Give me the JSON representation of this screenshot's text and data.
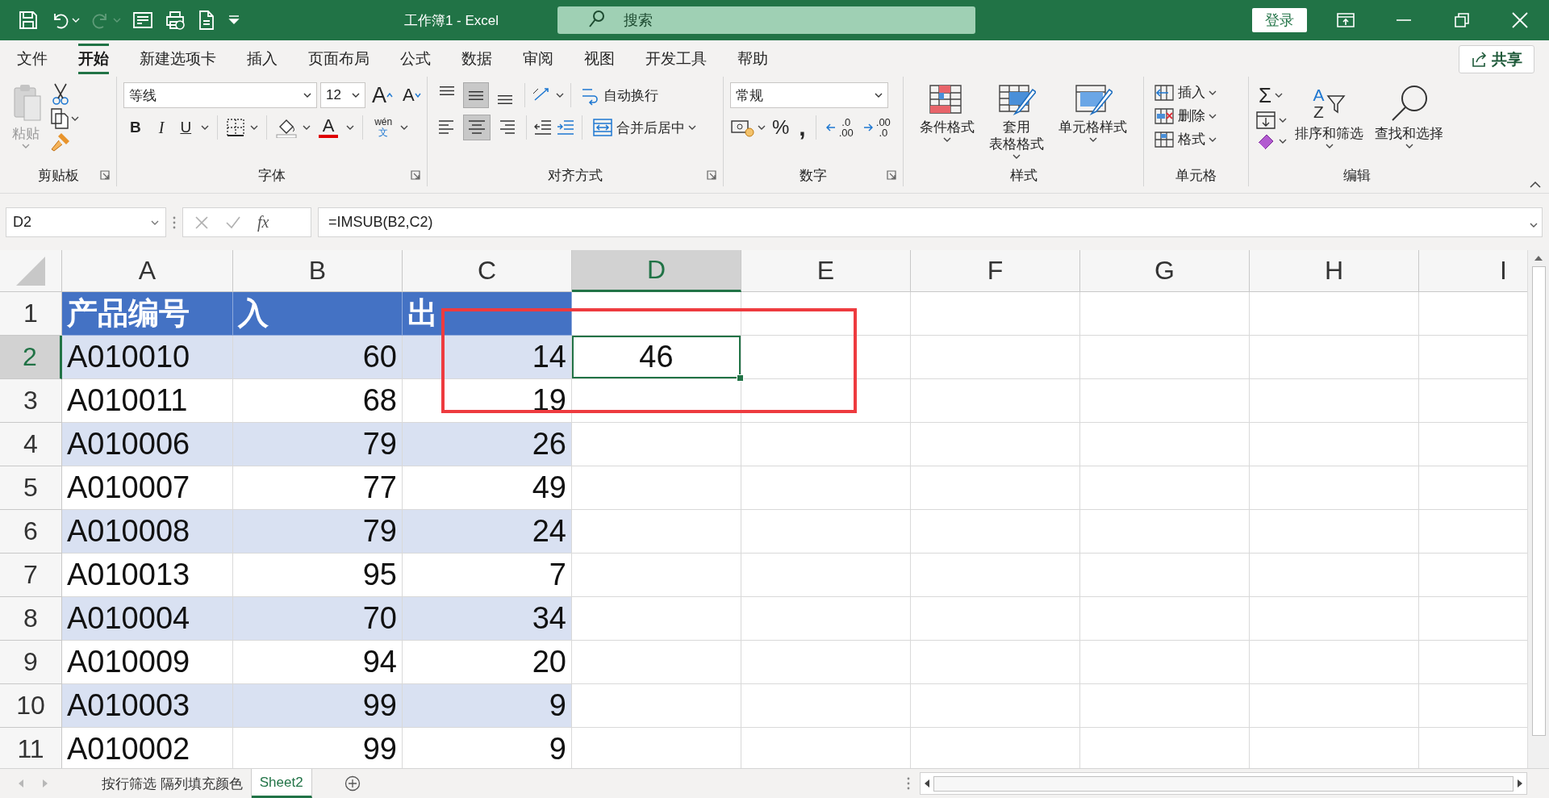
{
  "window": {
    "title": "工作簿1  -  Excel",
    "search_placeholder": "搜索",
    "sign_in": "登录"
  },
  "quick_access": [
    {
      "kind": "save",
      "disabled": false
    },
    {
      "kind": "undo",
      "disabled": false
    },
    {
      "kind": "redo",
      "disabled": true
    },
    {
      "kind": "form",
      "disabled": false
    },
    {
      "kind": "print",
      "disabled": false
    },
    {
      "kind": "document",
      "disabled": false
    },
    {
      "kind": "customize",
      "disabled": false
    }
  ],
  "tabs": [
    {
      "label": "文件",
      "selected": false
    },
    {
      "label": "开始",
      "selected": true
    },
    {
      "label": "新建选项卡",
      "selected": false
    },
    {
      "label": "插入",
      "selected": false
    },
    {
      "label": "页面布局",
      "selected": false
    },
    {
      "label": "公式",
      "selected": false
    },
    {
      "label": "数据",
      "selected": false
    },
    {
      "label": "审阅",
      "selected": false
    },
    {
      "label": "视图",
      "selected": false
    },
    {
      "label": "开发工具",
      "selected": false
    },
    {
      "label": "帮助",
      "selected": false
    }
  ],
  "share": "共享",
  "ribbon": {
    "clipboard": {
      "paste": "粘贴",
      "paste_disabled": true,
      "label": "剪贴板"
    },
    "font": {
      "name": "等线",
      "size": "12",
      "grow": "A",
      "shrink": "A",
      "bold": "B",
      "italic": "I",
      "underline": "U",
      "color_letter": "A",
      "phonetic_top": "wén",
      "phonetic_bottom": "文",
      "label": "字体"
    },
    "alignment": {
      "vertical": [
        {
          "kind": "top",
          "selected": false
        },
        {
          "kind": "middle",
          "selected": true
        },
        {
          "kind": "bottom",
          "selected": false
        }
      ],
      "horizontal": [
        {
          "kind": "left",
          "selected": false
        },
        {
          "kind": "center",
          "selected": true
        },
        {
          "kind": "right",
          "selected": false
        }
      ],
      "wrap": "自动换行",
      "merge": "合并后居中",
      "label": "对齐方式"
    },
    "number": {
      "format": "常规",
      "percent": "%",
      "comma": ",",
      "increase_decimal": [
        ".0",
        ".00"
      ],
      "decrease_decimal": [
        ".00",
        ".0"
      ],
      "label": "数字"
    },
    "styles": {
      "buttons": [
        {
          "kind": "conditional",
          "lines": [
            "条件格式"
          ]
        },
        {
          "kind": "table",
          "lines": [
            "套用",
            "表格格式"
          ]
        },
        {
          "kind": "cell",
          "lines": [
            "单元格样式"
          ]
        }
      ],
      "label": "样式"
    },
    "cells": {
      "buttons": [
        {
          "kind": "insert",
          "label": "插入"
        },
        {
          "kind": "delete",
          "label": "删除"
        },
        {
          "kind": "format",
          "label": "格式"
        }
      ],
      "label": "单元格"
    },
    "editing": {
      "sum": "Σ",
      "sort_letters": [
        "A",
        "Z"
      ],
      "sort": "排序和筛选",
      "find": "查找和选择",
      "label": "编辑"
    }
  },
  "formula_bar": {
    "name_box": "D2",
    "fx": "fx",
    "formula": "=IMSUB(B2,C2)"
  },
  "sheet": {
    "columns": [
      {
        "label": "A",
        "selected": false
      },
      {
        "label": "B",
        "selected": false
      },
      {
        "label": "C",
        "selected": false
      },
      {
        "label": "D",
        "selected": true
      },
      {
        "label": "E",
        "selected": false
      },
      {
        "label": "F",
        "selected": false
      },
      {
        "label": "G",
        "selected": false
      },
      {
        "label": "H",
        "selected": false
      },
      {
        "label": "I",
        "selected": false
      }
    ],
    "rows": [
      {
        "number": "1",
        "kind": "header",
        "selected": false,
        "cells": [
          "产品编号",
          "入",
          "出"
        ]
      },
      {
        "number": "2",
        "kind": "band",
        "selected": true,
        "cells": [
          "A010010",
          "60",
          "14",
          "46"
        ]
      },
      {
        "number": "3",
        "kind": "plain",
        "selected": false,
        "cells": [
          "A010011",
          "68",
          "19"
        ]
      },
      {
        "number": "4",
        "kind": "band",
        "selected": false,
        "cells": [
          "A010006",
          "79",
          "26"
        ]
      },
      {
        "number": "5",
        "kind": "plain",
        "selected": false,
        "cells": [
          "A010007",
          "77",
          "49"
        ]
      },
      {
        "number": "6",
        "kind": "band",
        "selected": false,
        "cells": [
          "A010008",
          "79",
          "24"
        ]
      },
      {
        "number": "7",
        "kind": "plain",
        "selected": false,
        "cells": [
          "A010013",
          "95",
          "7"
        ]
      },
      {
        "number": "8",
        "kind": "band",
        "selected": false,
        "cells": [
          "A010004",
          "70",
          "34"
        ]
      },
      {
        "number": "9",
        "kind": "plain",
        "selected": false,
        "cells": [
          "A010009",
          "94",
          "20"
        ]
      },
      {
        "number": "10",
        "kind": "band",
        "selected": false,
        "cells": [
          "A010003",
          "99",
          "9"
        ]
      },
      {
        "number": "11",
        "kind": "plain",
        "selected": false,
        "cells": [
          "A010002",
          "99",
          "9"
        ]
      }
    ],
    "highlight": {
      "color": "#ee3b3f"
    }
  },
  "sheet_tabs": [
    {
      "label": "按行筛选 隔列填充颜色",
      "selected": false
    },
    {
      "label": "Sheet2",
      "selected": true
    }
  ]
}
